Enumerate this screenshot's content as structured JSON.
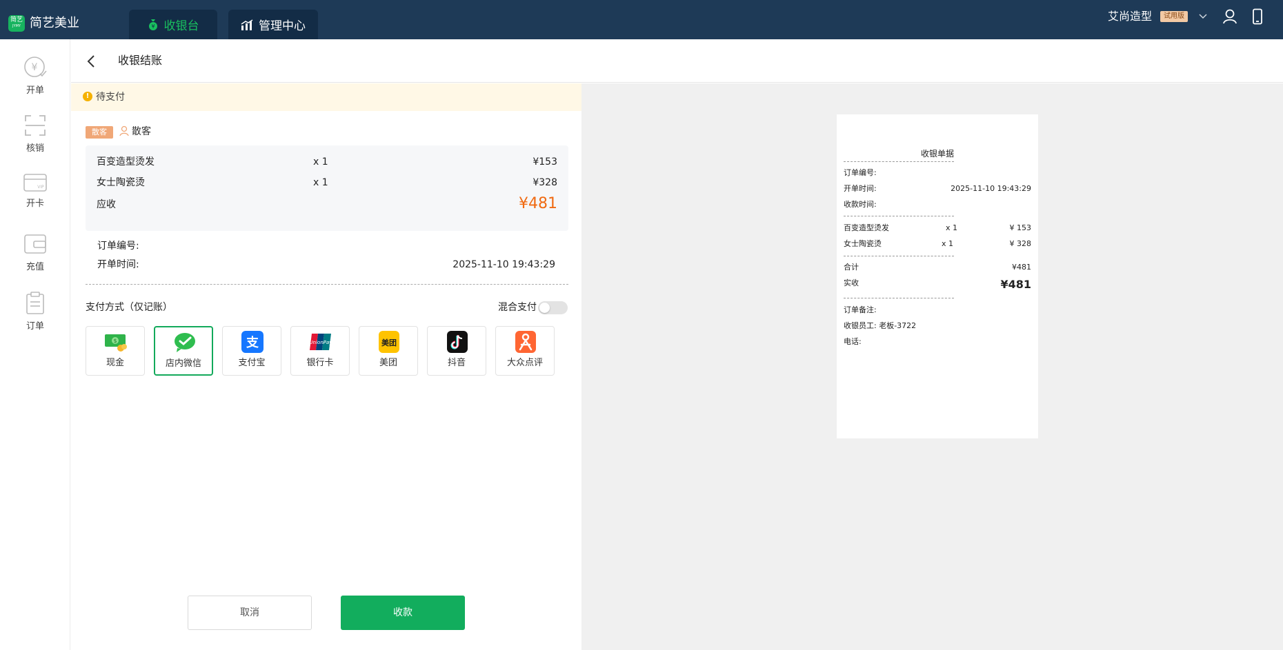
{
  "app": {
    "logo_text": "简艺",
    "logo_sub": "JYMY",
    "brand": "简艺美业"
  },
  "nav": {
    "tabs": [
      {
        "label": "收银台"
      },
      {
        "label": "管理中心"
      }
    ]
  },
  "account": {
    "store": "艾尚造型",
    "badge": "试用版"
  },
  "sidebar": {
    "items": [
      {
        "label": "开单"
      },
      {
        "label": "核销"
      },
      {
        "label": "开卡"
      },
      {
        "label": "充值"
      },
      {
        "label": "订单"
      }
    ]
  },
  "page": {
    "title": "收银结账"
  },
  "status": {
    "text": "待支付"
  },
  "customer": {
    "badge": "散客",
    "name": "散客"
  },
  "order": {
    "items": [
      {
        "name": "百变造型烫发",
        "qty": "x 1",
        "price": "¥153"
      },
      {
        "name": "女士陶瓷烫",
        "qty": "x 1",
        "price": "¥328"
      }
    ],
    "due_label": "应收",
    "due_value": "¥481",
    "number_label": "订单编号:",
    "time_label": "开单时间:",
    "time_value": "2025-11-10 19:43:29"
  },
  "payment": {
    "label": "支付方式（仅记账）",
    "mixed_label": "混合支付",
    "mixed_enabled": false,
    "methods": [
      {
        "label": "现金",
        "icon": "cash-icon"
      },
      {
        "label": "店内微信",
        "icon": "wechat-icon",
        "selected": true
      },
      {
        "label": "支付宝",
        "icon": "alipay-icon"
      },
      {
        "label": "银行卡",
        "icon": "unionpay-icon"
      },
      {
        "label": "美团",
        "icon": "meituan-icon"
      },
      {
        "label": "抖音",
        "icon": "douyin-icon"
      },
      {
        "label": "大众点评",
        "icon": "dianping-icon"
      }
    ]
  },
  "actions": {
    "cancel": "取消",
    "pay": "收款"
  },
  "receipt": {
    "title": "收银单据",
    "order_no_label": "订单编号:",
    "open_time_label": "开单时间:",
    "open_time_value": "2025-11-10 19:43:29",
    "pay_time_label": "收款时间:",
    "items": [
      {
        "name": "百变造型烫发",
        "qty": "x 1",
        "price": "¥ 153"
      },
      {
        "name": "女士陶瓷烫",
        "qty": "x 1",
        "price": "¥ 328"
      }
    ],
    "total_label": "合计",
    "total_value": "¥481",
    "paid_label": "实收",
    "paid_value": "¥481",
    "remark_label": "订单备注:",
    "staff_label": "收银员工: 老板-3722",
    "phone_label": "电话:"
  },
  "colors": {
    "topbar": "#1e3a57",
    "accent": "#12ad5d",
    "amount": "#f06a12",
    "pending_bg": "#fff8e6"
  }
}
